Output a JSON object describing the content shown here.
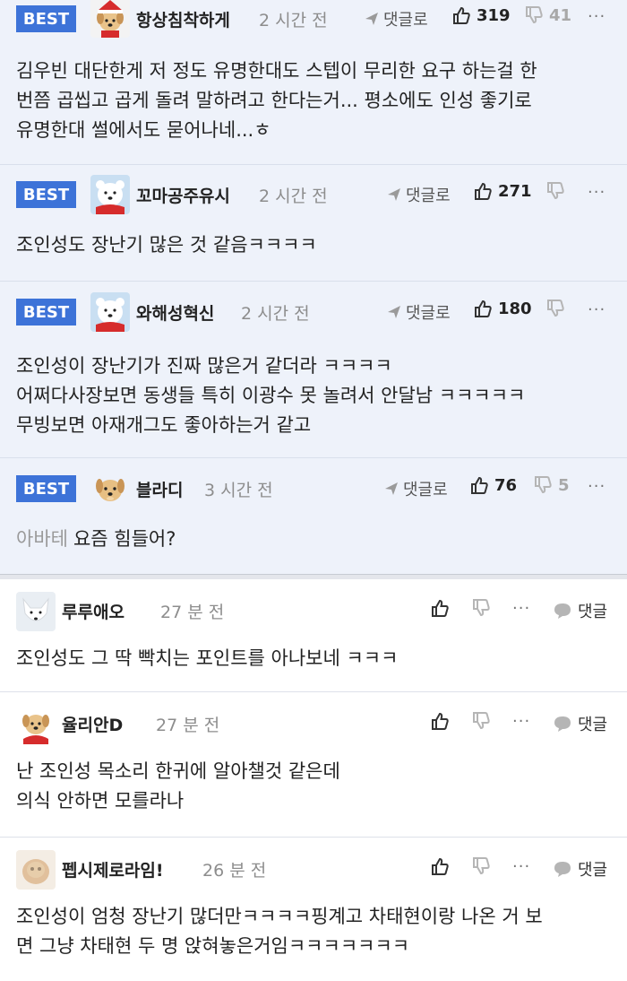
{
  "best_comments": [
    {
      "badge": "BEST",
      "nickname": "항상침착하게",
      "time": "2 시간 전",
      "reply_label": "댓글로",
      "likes": "319",
      "dislikes": "41",
      "body_lines": [
        "김우빈 대단한게 저 정도 유명한대도 스텝이 무리한 요구 하는걸 한",
        "번쯤 곱씹고 곱게 돌려 말하려고 한다는거... 평소에도 인성 좋기로",
        "유명한대 썰에서도 묻어나네...ㅎ"
      ]
    },
    {
      "badge": "BEST",
      "nickname": "꼬마공주유시",
      "time": "2 시간 전",
      "reply_label": "댓글로",
      "likes": "271",
      "dislikes": "",
      "body_lines": [
        "조인성도 장난기 많은 것 같음ㅋㅋㅋㅋ"
      ]
    },
    {
      "badge": "BEST",
      "nickname": "와해성혁신",
      "time": "2 시간 전",
      "reply_label": "댓글로",
      "likes": "180",
      "dislikes": "",
      "body_lines": [
        "조인성이 장난기가 진짜 많은거 같더라 ㅋㅋㅋㅋ",
        "어쩌다사장보면 동생들 특히 이광수 못 놀려서 안달남 ㅋㅋㅋㅋㅋ",
        "무빙보면 아재개그도 좋아하는거 같고"
      ]
    },
    {
      "badge": "BEST",
      "nickname": "블라디",
      "time": "3 시간 전",
      "reply_label": "댓글로",
      "likes": "76",
      "dislikes": "5",
      "mention": "아바테",
      "body_lines": [
        "요즘 힘들어?"
      ]
    }
  ],
  "comments": [
    {
      "nickname": "루루애오",
      "time": "27 분 전",
      "reply_label": "댓글",
      "body_lines": [
        "조인성도 그 딱 빡치는 포인트를 아나보네 ㅋㅋㅋ"
      ]
    },
    {
      "nickname": "율리안D",
      "time": "27 분 전",
      "reply_label": "댓글",
      "body_lines": [
        "난 조인성 목소리 한귀에 알아챌것 같은데",
        "의식 안하면 모를라나"
      ]
    },
    {
      "nickname": "펩시제로라임!",
      "time": "26 분 전",
      "reply_label": "댓글",
      "body_lines": [
        "조인성이 엄청 장난기 많더만ㅋㅋㅋㅋ핑계고 차태현이랑 나온 거 보",
        "면 그냥 차태현 두 명 앉혀놓은거임ㅋㅋㅋㅋㅋㅋㅋ"
      ]
    }
  ],
  "more_label": "···",
  "colors": {
    "badge": "#3d73d8",
    "best_bg": "#eef2fa"
  },
  "avatars": [
    "puppy-santa-icon",
    "polar-bear-icon",
    "polar-bear-icon",
    "puppy-icon",
    "white-fox-icon",
    "puppy-santa-icon",
    "blurred-puppy-icon"
  ]
}
